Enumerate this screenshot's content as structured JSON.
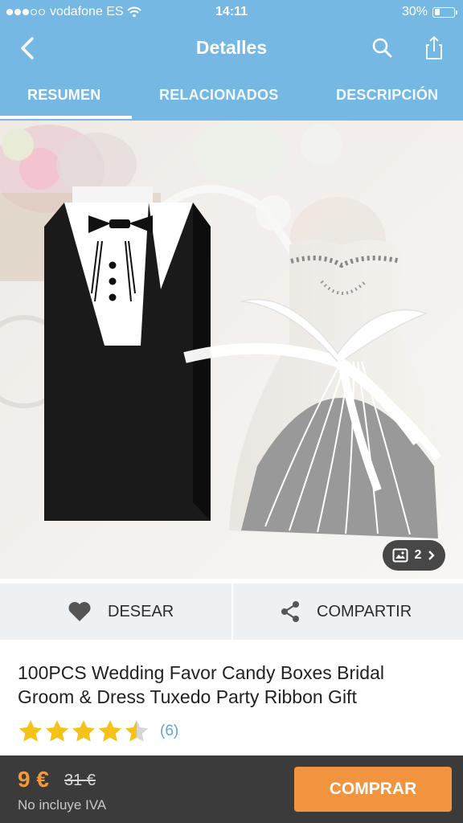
{
  "status_bar": {
    "carrier": "vodafone ES",
    "time": "14:11",
    "battery": "30%",
    "battery_level": 0.3
  },
  "nav": {
    "title": "Detalles",
    "back_icon": "chevron-left-icon",
    "search_icon": "search-icon",
    "share_icon": "share-icon"
  },
  "tabs": [
    {
      "label": "RESUMEN",
      "active": true
    },
    {
      "label": "RELACIONADOS",
      "active": false
    },
    {
      "label": "DESCRIPCIÓN",
      "active": false
    }
  ],
  "gallery": {
    "count": "2",
    "icon": "image-icon"
  },
  "actions": {
    "wish_label": "DESEAR",
    "share_label": "COMPARTIR"
  },
  "product": {
    "title_line1": "100PCS Wedding Favor Candy Boxes Bridal",
    "title_line2": "Groom & Dress Tuxedo Party Ribbon Gift",
    "rating": 4.5,
    "review_count": "(6)"
  },
  "footer": {
    "price": "9 €",
    "old_price": "31 €",
    "tax_note": "No incluye IVA",
    "buy_label": "COMPRAR"
  },
  "colors": {
    "header": "#74b8e3",
    "accent": "#f19440",
    "star": "#f6c21a",
    "footer": "#3b3b3b"
  }
}
